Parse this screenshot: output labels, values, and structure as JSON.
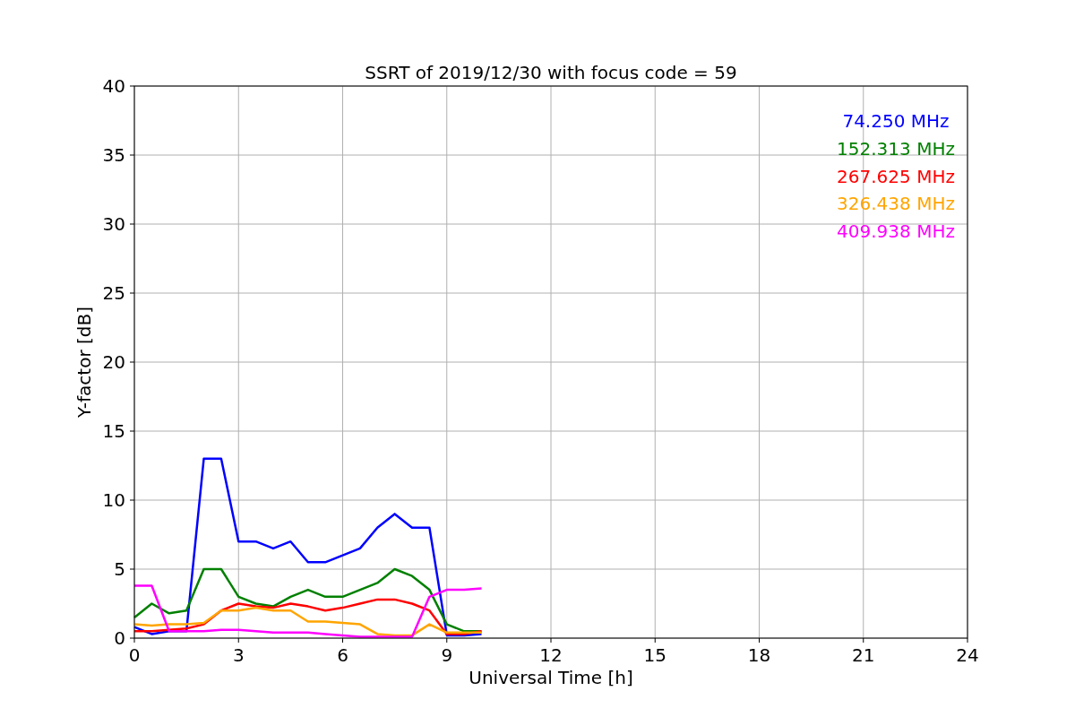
{
  "figure": {
    "chart_data": {
      "type": "line",
      "title": "SSRT of 2019/12/30 with focus code = 59",
      "xlabel": "Universal Time [h]",
      "ylabel": "Y-factor [dB]",
      "x": [
        0,
        0.5,
        1,
        1.5,
        2,
        2.5,
        3,
        3.5,
        4,
        4.5,
        5,
        5.5,
        6,
        6.5,
        7,
        7.5,
        8,
        8.5,
        9,
        9.5,
        10
      ],
      "series": [
        {
          "name": "74.250 MHz",
          "color": "#0000ff",
          "values": [
            0.8,
            0.3,
            0.5,
            0.5,
            13,
            13,
            7,
            7,
            6.5,
            7,
            5.5,
            5.5,
            6,
            6.5,
            8,
            9,
            8,
            8,
            0.2,
            0.2,
            0.3
          ]
        },
        {
          "name": "152.313 MHz",
          "color": "#008000",
          "values": [
            1.5,
            2.5,
            1.8,
            2,
            5,
            5,
            3,
            2.5,
            2.3,
            3,
            3.5,
            3,
            3,
            3.5,
            4,
            5,
            4.5,
            3.5,
            1,
            0.5,
            0.5
          ]
        },
        {
          "name": "267.625 MHz",
          "color": "#ff0000",
          "values": [
            0.5,
            0.5,
            0.6,
            0.7,
            1,
            2,
            2.5,
            2.3,
            2.2,
            2.5,
            2.3,
            2,
            2.2,
            2.5,
            2.8,
            2.8,
            2.5,
            2,
            0.3,
            0.3,
            0.5
          ]
        },
        {
          "name": "326.438 MHz",
          "color": "#ffa500",
          "values": [
            1,
            0.9,
            1,
            1,
            1.1,
            2,
            2,
            2.2,
            2,
            2,
            1.2,
            1.2,
            1.1,
            1,
            0.3,
            0.2,
            0.2,
            1,
            0.4,
            0.4,
            0.4
          ]
        },
        {
          "name": "409.938 MHz",
          "color": "#ff00ff",
          "values": [
            3.8,
            3.8,
            0.5,
            0.5,
            0.5,
            0.6,
            0.6,
            0.5,
            0.4,
            0.4,
            0.4,
            0.3,
            0.2,
            0.1,
            0.1,
            0.1,
            0.1,
            3,
            3.5,
            3.5,
            3.6
          ]
        }
      ],
      "grid": true,
      "xlim": [
        0,
        24
      ],
      "ylim": [
        0,
        40
      ],
      "xticks": [
        0,
        3,
        6,
        9,
        12,
        15,
        18,
        21,
        24
      ],
      "yticks": [
        0,
        5,
        10,
        15,
        20,
        25,
        30,
        35,
        40
      ]
    }
  }
}
